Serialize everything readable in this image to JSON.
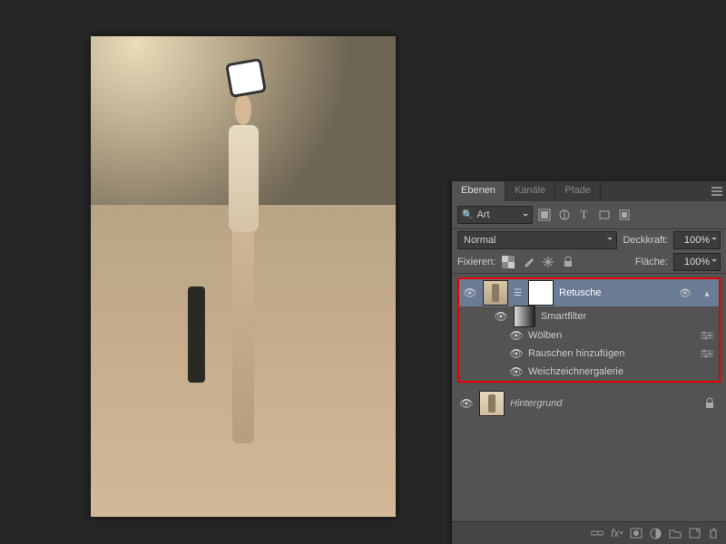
{
  "tabs": {
    "layers": "Ebenen",
    "channels": "Kanäle",
    "paths": "Pfade"
  },
  "filter": {
    "label": "Art"
  },
  "blend": {
    "mode": "Normal",
    "opacity_label": "Deckkraft:",
    "opacity_value": "100%"
  },
  "lock": {
    "label": "Fixieren:",
    "fill_label": "Fläche:",
    "fill_value": "100%"
  },
  "layer_retusche": {
    "name": "Retusche"
  },
  "smartfilter": {
    "label": "Smartfilter"
  },
  "filters": {
    "f1": "Wölben",
    "f2": "Rauschen hinzufügen",
    "f3": "Weichzeichnergalerie"
  },
  "layer_bg": {
    "name": "Hintergrund"
  }
}
